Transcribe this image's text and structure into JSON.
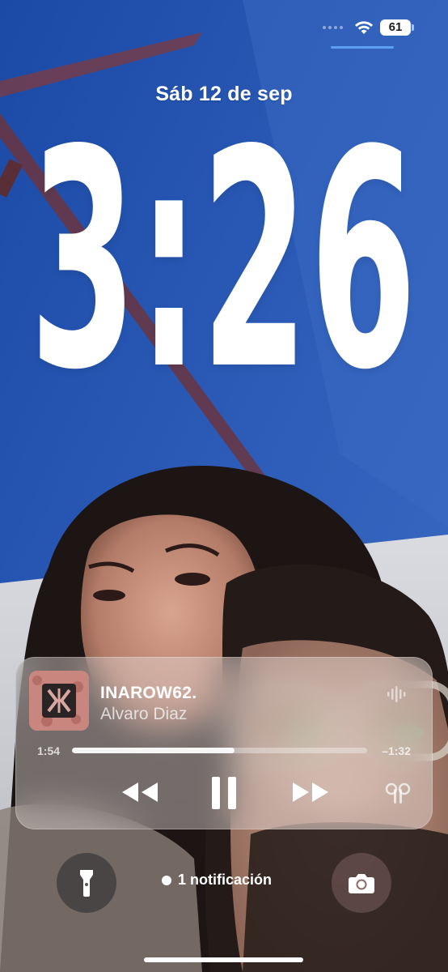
{
  "status_bar": {
    "battery_level": "61",
    "wifi_icon": "wifi-icon",
    "signal_icon": "cellular-dots-icon"
  },
  "lock_screen": {
    "date": "Sáb 12 de sep",
    "time": "3:26"
  },
  "now_playing": {
    "title": "INAROW62.",
    "artist": "Alvaro Diaz",
    "elapsed": "1:54",
    "remaining": "–1:32",
    "progress_fraction": 0.55,
    "icons": {
      "waveform": "waveform-icon",
      "rewind": "rewind-icon",
      "pause": "pause-icon",
      "forward": "fast-forward-icon",
      "output": "airpods-icon"
    }
  },
  "bottom": {
    "notification_text": "1 notificación",
    "flashlight_icon": "flashlight-icon",
    "camera_icon": "camera-icon"
  },
  "colors": {
    "sky_blue": "#2a57b0",
    "text": "#ffffff",
    "progress_track": "rgba(255,255,255,0.35)"
  }
}
